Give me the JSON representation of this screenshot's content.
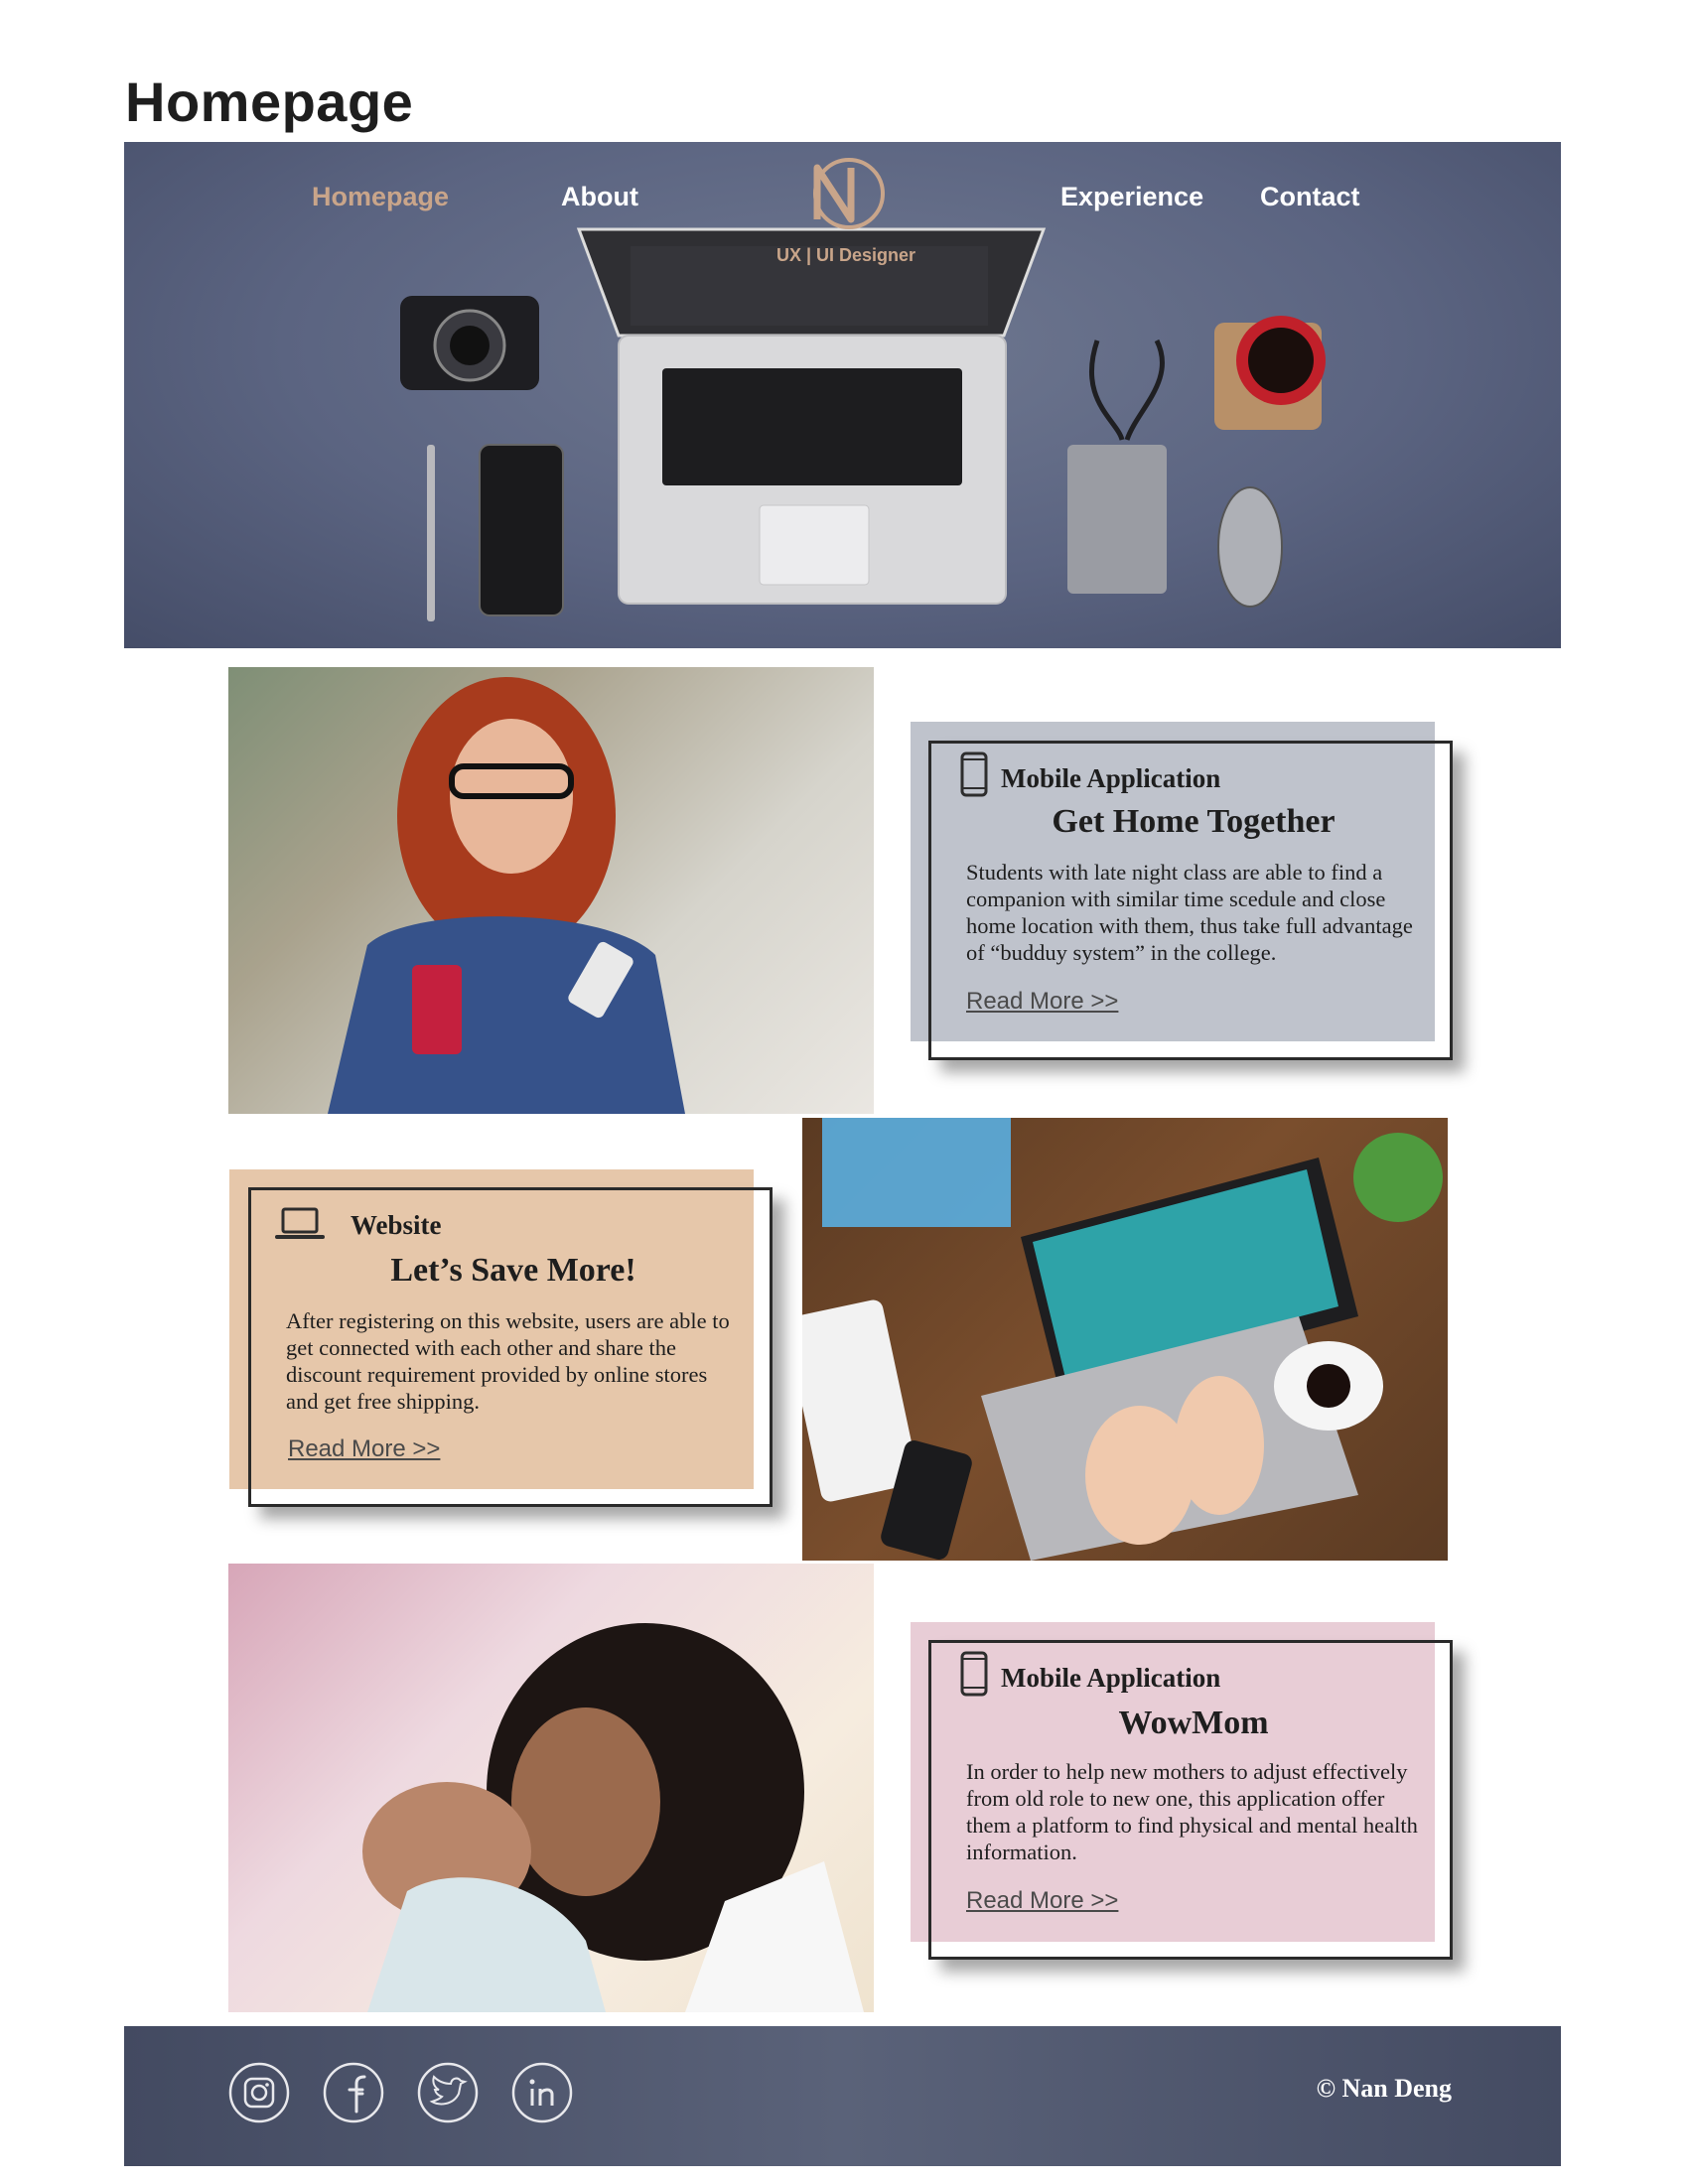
{
  "page": {
    "title": "Homepage"
  },
  "nav": {
    "items": [
      {
        "label": "Homepage",
        "active": true
      },
      {
        "label": "About",
        "active": false
      },
      {
        "label": "Experience",
        "active": false
      },
      {
        "label": "Contact",
        "active": false
      }
    ],
    "logo_tagline": "UX | UI Designer",
    "active_color": "#c9a58a"
  },
  "projects": [
    {
      "category": "Mobile Application",
      "category_icon": "smartphone-icon",
      "title": "Get Home Together",
      "description": "Students with late night class are able to find a companion with similar time scedule and close home location with them, thus take full advantage of “budduy system” in the college.",
      "link_label": "Read More >>",
      "card_color": "#bfc3cc"
    },
    {
      "category": "Website",
      "category_icon": "laptop-icon",
      "title": "Let’s Save More!",
      "description": "After registering on this website, users are able to get connected with each other and share the discount requirement provided by online stores and get free shipping.",
      "link_label": "Read More >>",
      "card_color": "#e6c7aa"
    },
    {
      "category": "Mobile Application",
      "category_icon": "smartphone-icon",
      "title": "WowMom",
      "description": "In order to help new mothers to adjust effectively from old role to new one, this application offer them a platform to find physical and mental health information.",
      "link_label": "Read More >>",
      "card_color": "#e8cdd6"
    }
  ],
  "footer": {
    "social_icons": [
      "instagram-icon",
      "facebook-icon",
      "twitter-icon",
      "linkedin-icon"
    ],
    "copyright": "© Nan Deng"
  }
}
